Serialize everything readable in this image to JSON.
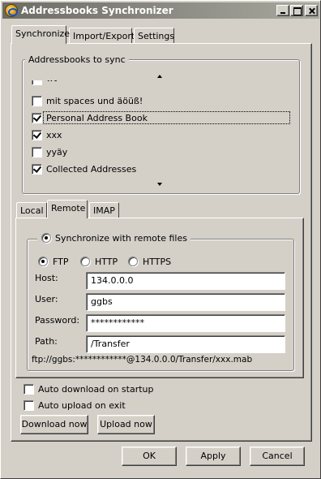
{
  "window": {
    "title": "Addressbooks Synchronizer"
  },
  "main_tabs": [
    {
      "label": "Synchronize"
    },
    {
      "label": "Import/Export"
    },
    {
      "label": "Settings"
    }
  ],
  "addressbooks": {
    "group_label": "Addressbooks to sync",
    "items": [
      {
        "label": "wt",
        "checked": false
      },
      {
        "label": "mit spaces und äöüß!",
        "checked": false
      },
      {
        "label": "Personal Address Book",
        "checked": true
      },
      {
        "label": "xxx",
        "checked": true
      },
      {
        "label": "yyäy",
        "checked": false
      },
      {
        "label": "Collected Addresses",
        "checked": true
      }
    ]
  },
  "sub_tabs": [
    {
      "label": "Local"
    },
    {
      "label": "Remote"
    },
    {
      "label": "IMAP"
    }
  ],
  "remote": {
    "sync_radio_label": "Synchronize with remote files",
    "protocols": [
      {
        "label": "FTP",
        "selected": true
      },
      {
        "label": "HTTP",
        "selected": false
      },
      {
        "label": "HTTPS",
        "selected": false
      }
    ],
    "fields": {
      "host_label": "Host:",
      "host_value": "134.0.0.0",
      "user_label": "User:",
      "user_value": "ggbs",
      "password_label": "Password:",
      "password_value": "************",
      "path_label": "Path:",
      "path_value": "/Transfer"
    },
    "url_preview": "ftp://ggbs:************@134.0.0.0/Transfer/xxx.mab"
  },
  "options": {
    "auto_download_label": "Auto download on startup",
    "auto_upload_label": "Auto upload on exit"
  },
  "actions": {
    "download_label": "Download now",
    "upload_label": "Upload now"
  },
  "dialog_buttons": {
    "ok_label": "OK",
    "apply_label": "Apply",
    "cancel_label": "Cancel"
  }
}
